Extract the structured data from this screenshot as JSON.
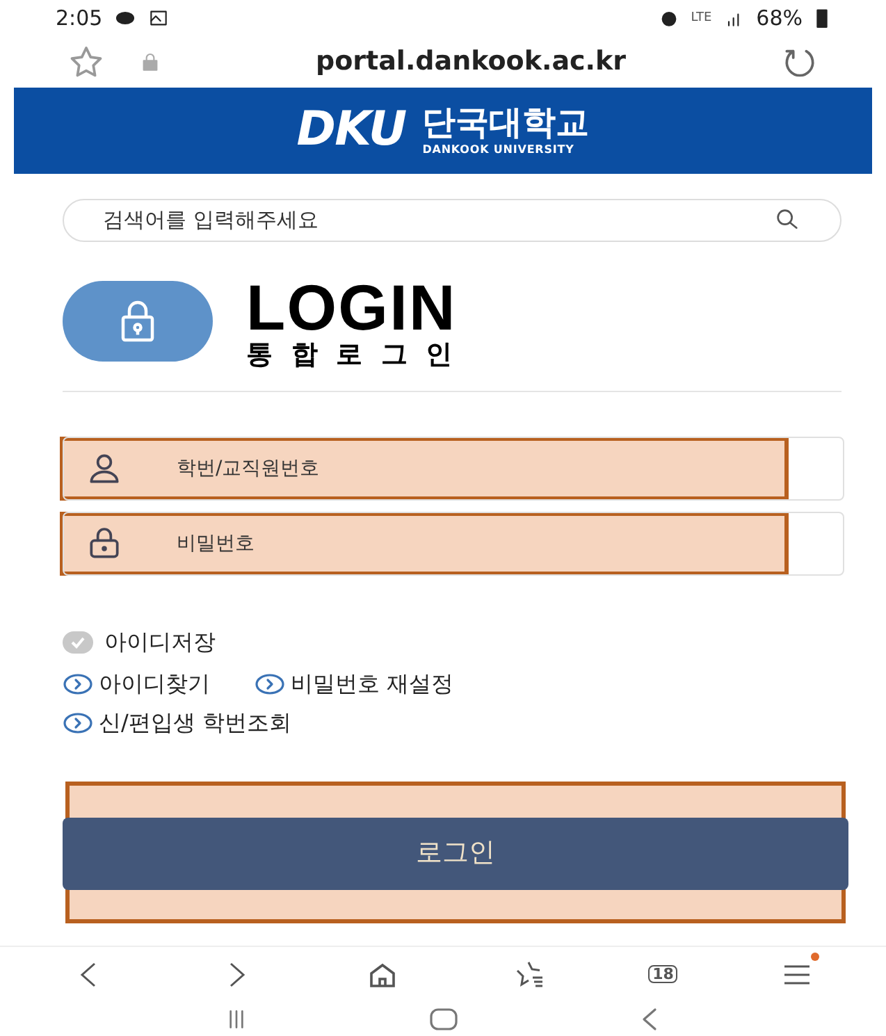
{
  "status_bar": {
    "time": "2:05",
    "network": "LTE",
    "battery": "68%"
  },
  "address_bar": {
    "url": "portal.dankook.ac.kr"
  },
  "header": {
    "logo_mark": "DKU",
    "name": "단국대학교",
    "name_en": "DANKOOK UNIVERSITY"
  },
  "search": {
    "placeholder": "검색어를 입력해주세요"
  },
  "login_title": {
    "title": "LOGIN",
    "subtitle": "통합로그인"
  },
  "fields": [
    {
      "kind": "user",
      "placeholder": "학번/교직원번호",
      "highlighted": true
    },
    {
      "kind": "password",
      "placeholder": "비밀번호",
      "highlighted": true
    }
  ],
  "save_id": {
    "label": "아이디저장",
    "checked": false
  },
  "links": [
    {
      "label": "아이디찾기"
    },
    {
      "label": "비밀번호 재설정"
    },
    {
      "label": "신/편입생 학번조회"
    }
  ],
  "login_button": {
    "label": "로그인",
    "highlighted": true
  },
  "browser_nav": {
    "tab_count": "18"
  }
}
